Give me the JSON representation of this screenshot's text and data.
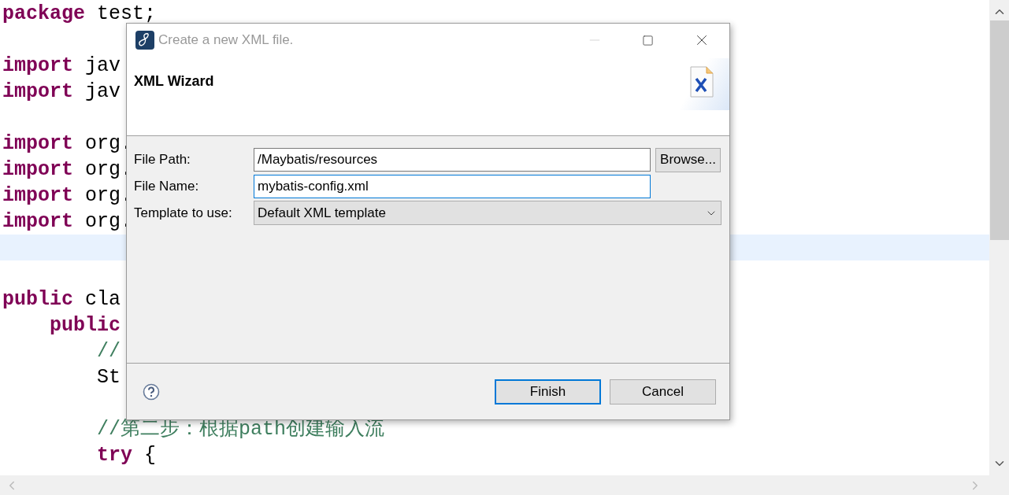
{
  "editor": {
    "lines": [
      {
        "kind": "code",
        "tokens": [
          {
            "kind": "keyword",
            "text": "package"
          },
          {
            "kind": "plain",
            "text": " test;"
          }
        ]
      },
      {
        "kind": "blank"
      },
      {
        "kind": "code",
        "tokens": [
          {
            "kind": "keyword",
            "text": "import"
          },
          {
            "kind": "plain",
            "text": " jav"
          }
        ]
      },
      {
        "kind": "code",
        "tokens": [
          {
            "kind": "keyword",
            "text": "import"
          },
          {
            "kind": "plain",
            "text": " jav"
          }
        ]
      },
      {
        "kind": "blank"
      },
      {
        "kind": "code",
        "tokens": [
          {
            "kind": "keyword",
            "text": "import"
          },
          {
            "kind": "plain",
            "text": " org."
          }
        ]
      },
      {
        "kind": "code",
        "tokens": [
          {
            "kind": "keyword",
            "text": "import"
          },
          {
            "kind": "plain",
            "text": " org."
          }
        ]
      },
      {
        "kind": "code",
        "tokens": [
          {
            "kind": "keyword",
            "text": "import"
          },
          {
            "kind": "plain",
            "text": " org."
          }
        ]
      },
      {
        "kind": "code",
        "tokens": [
          {
            "kind": "keyword",
            "text": "import"
          },
          {
            "kind": "plain",
            "text": " org."
          }
        ]
      },
      {
        "kind": "blank",
        "current": true
      },
      {
        "kind": "blank"
      },
      {
        "kind": "code",
        "tokens": [
          {
            "kind": "keyword",
            "text": "public"
          },
          {
            "kind": "plain",
            "text": " cla"
          }
        ]
      },
      {
        "kind": "code",
        "tokens": [
          {
            "kind": "keyword",
            "text": "    public"
          }
        ]
      },
      {
        "kind": "code",
        "tokens": [
          {
            "kind": "comment",
            "text": "        //"
          }
        ]
      },
      {
        "kind": "code",
        "tokens": [
          {
            "kind": "plain",
            "text": "        St"
          }
        ]
      },
      {
        "kind": "blank"
      },
      {
        "kind": "code",
        "tokens": [
          {
            "kind": "comment",
            "text": "        //第二步：根据path创建输入流"
          }
        ]
      },
      {
        "kind": "code",
        "tokens": [
          {
            "kind": "keyword",
            "text": "        try"
          },
          {
            "kind": "plain",
            "text": " {"
          }
        ]
      }
    ]
  },
  "dialog": {
    "title": "Create a new XML file.",
    "heading": "XML Wizard",
    "fields": [
      {
        "kind": "text",
        "label": "File Path:",
        "value": "/Maybatis/resources",
        "focused": false,
        "button": "Browse..."
      },
      {
        "kind": "text",
        "label": "File Name:",
        "value": "mybatis-config.xml",
        "focused": true
      },
      {
        "kind": "select",
        "label": "Template to use:",
        "value": "Default XML template"
      }
    ],
    "buttons": [
      {
        "label": "Finish",
        "default": true
      },
      {
        "label": "Cancel",
        "default": false
      }
    ]
  }
}
